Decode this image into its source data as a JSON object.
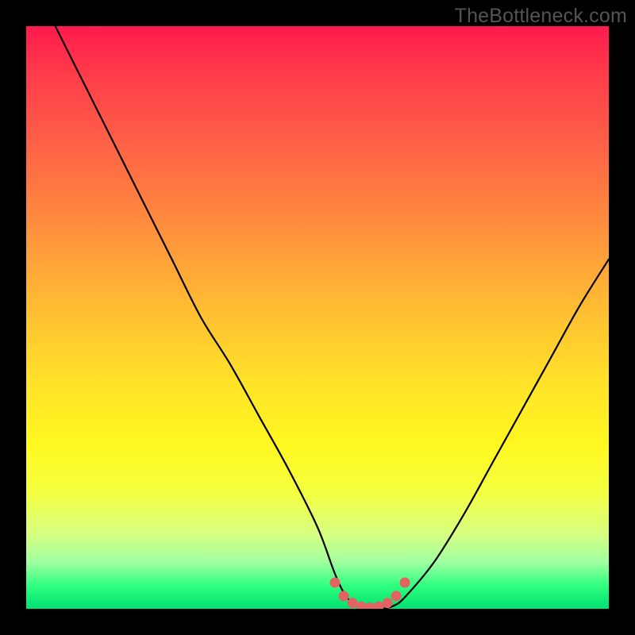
{
  "watermark": {
    "text": "TheBottleneck.com"
  },
  "chart_data": {
    "type": "line",
    "title": "",
    "xlabel": "",
    "ylabel": "",
    "xlim": [
      0,
      100
    ],
    "ylim": [
      0,
      100
    ],
    "grid": false,
    "legend": false,
    "series": [
      {
        "name": "bottleneck-curve",
        "color": "#000000",
        "x": [
          5,
          10,
          15,
          20,
          25,
          30,
          35,
          40,
          45,
          50,
          53,
          55,
          57,
          59,
          61,
          63,
          65,
          70,
          75,
          80,
          85,
          90,
          95,
          100
        ],
        "y": [
          100,
          90,
          80,
          70,
          60,
          50,
          42,
          33,
          24,
          14,
          6,
          2,
          0.5,
          0,
          0,
          0.5,
          2,
          8,
          16,
          25,
          34,
          43,
          52,
          60
        ]
      },
      {
        "name": "valley-marker",
        "color": "#e36363",
        "x": [
          53,
          54.5,
          56,
          57.5,
          59,
          60.5,
          62,
          63.5,
          65
        ],
        "y": [
          4.5,
          2.2,
          1.0,
          0.4,
          0.2,
          0.4,
          1.0,
          2.2,
          4.5
        ]
      }
    ],
    "annotations": []
  }
}
